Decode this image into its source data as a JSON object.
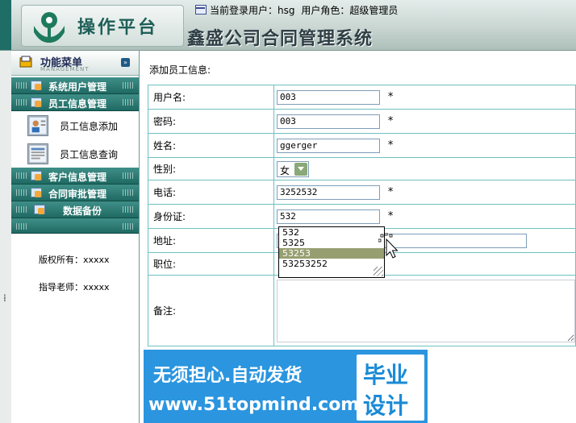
{
  "header": {
    "app_name": "操作平台",
    "system_title": "鑫盛公司合同管理系统",
    "current_user_label": "当前登录用户：hsg",
    "user_role_label": "用户角色：超级管理员"
  },
  "sidebar": {
    "menu_title": "功能菜单",
    "menu_subtitle": "MANAGEMENT",
    "sections": [
      {
        "label": "系统用户管理"
      },
      {
        "label": "员工信息管理"
      },
      {
        "label": "客户信息管理"
      },
      {
        "label": "合同审批管理"
      },
      {
        "label": "数据备份"
      }
    ],
    "employee_items": [
      {
        "label": "员工信息添加"
      },
      {
        "label": "员工信息查询"
      }
    ],
    "copyright": "版权所有：xxxxx",
    "advisor": "指导老师：xxxxx"
  },
  "form": {
    "heading": "添加员工信息:",
    "required_mark": "*",
    "fields": {
      "username": {
        "label": "用户名:",
        "value": "003"
      },
      "password": {
        "label": "密码:",
        "value": "003"
      },
      "name": {
        "label": "姓名:",
        "value": "ggerger"
      },
      "gender": {
        "label": "性别:",
        "value": "女"
      },
      "phone": {
        "label": "电话:",
        "value": "3252532"
      },
      "id_card": {
        "label": "身份证:",
        "value": "532"
      },
      "address": {
        "label": "地址:",
        "value": ""
      },
      "position": {
        "label": "职位:",
        "value": ""
      },
      "remark": {
        "label": "备注:",
        "value": ""
      }
    },
    "autocomplete": {
      "options": [
        "532",
        "5325",
        "53253",
        "53253252"
      ],
      "selected_index": 2
    }
  },
  "watermark": {
    "line1": "无须担心.自动发货",
    "line2": "www.51topmind.com",
    "badge_line1": "毕业",
    "badge_line2": "设计"
  }
}
